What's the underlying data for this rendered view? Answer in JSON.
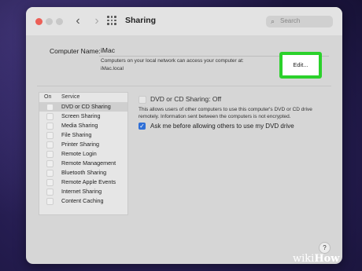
{
  "window": {
    "title": "Sharing"
  },
  "search": {
    "placeholder": "Search"
  },
  "computer_name": {
    "label": "Computer Name:",
    "value": "iMac",
    "description_line1": "Computers on your local network can access your computer at:",
    "description_line2": "iMac.local",
    "edit_label": "Edit..."
  },
  "services": {
    "header_on": "On",
    "header_service": "Service",
    "items": [
      {
        "label": "DVD or CD Sharing",
        "on": false,
        "selected": true
      },
      {
        "label": "Screen Sharing",
        "on": false
      },
      {
        "label": "Media Sharing",
        "on": false
      },
      {
        "label": "File Sharing",
        "on": false
      },
      {
        "label": "Printer Sharing",
        "on": false
      },
      {
        "label": "Remote Login",
        "on": false
      },
      {
        "label": "Remote Management",
        "on": false
      },
      {
        "label": "Bluetooth Sharing",
        "on": false
      },
      {
        "label": "Remote Apple Events",
        "on": false
      },
      {
        "label": "Internet Sharing",
        "on": false
      },
      {
        "label": "Content Caching",
        "on": false
      }
    ]
  },
  "detail": {
    "title": "DVD or CD Sharing: Off",
    "description_line1": "This allows users of other computers to use this computer's DVD or CD drive",
    "description_line2": "remotely. Information sent between the computers is not encrypted.",
    "ask_label": "Ask me before allowing others to use my DVD drive",
    "ask_checked": true
  },
  "help": {
    "label": "?"
  },
  "watermark": {
    "part1": "wiki",
    "part2": "How"
  },
  "colors": {
    "highlight": "#2bd12b",
    "accent": "#2f6fd6",
    "close": "#ec5f57"
  }
}
